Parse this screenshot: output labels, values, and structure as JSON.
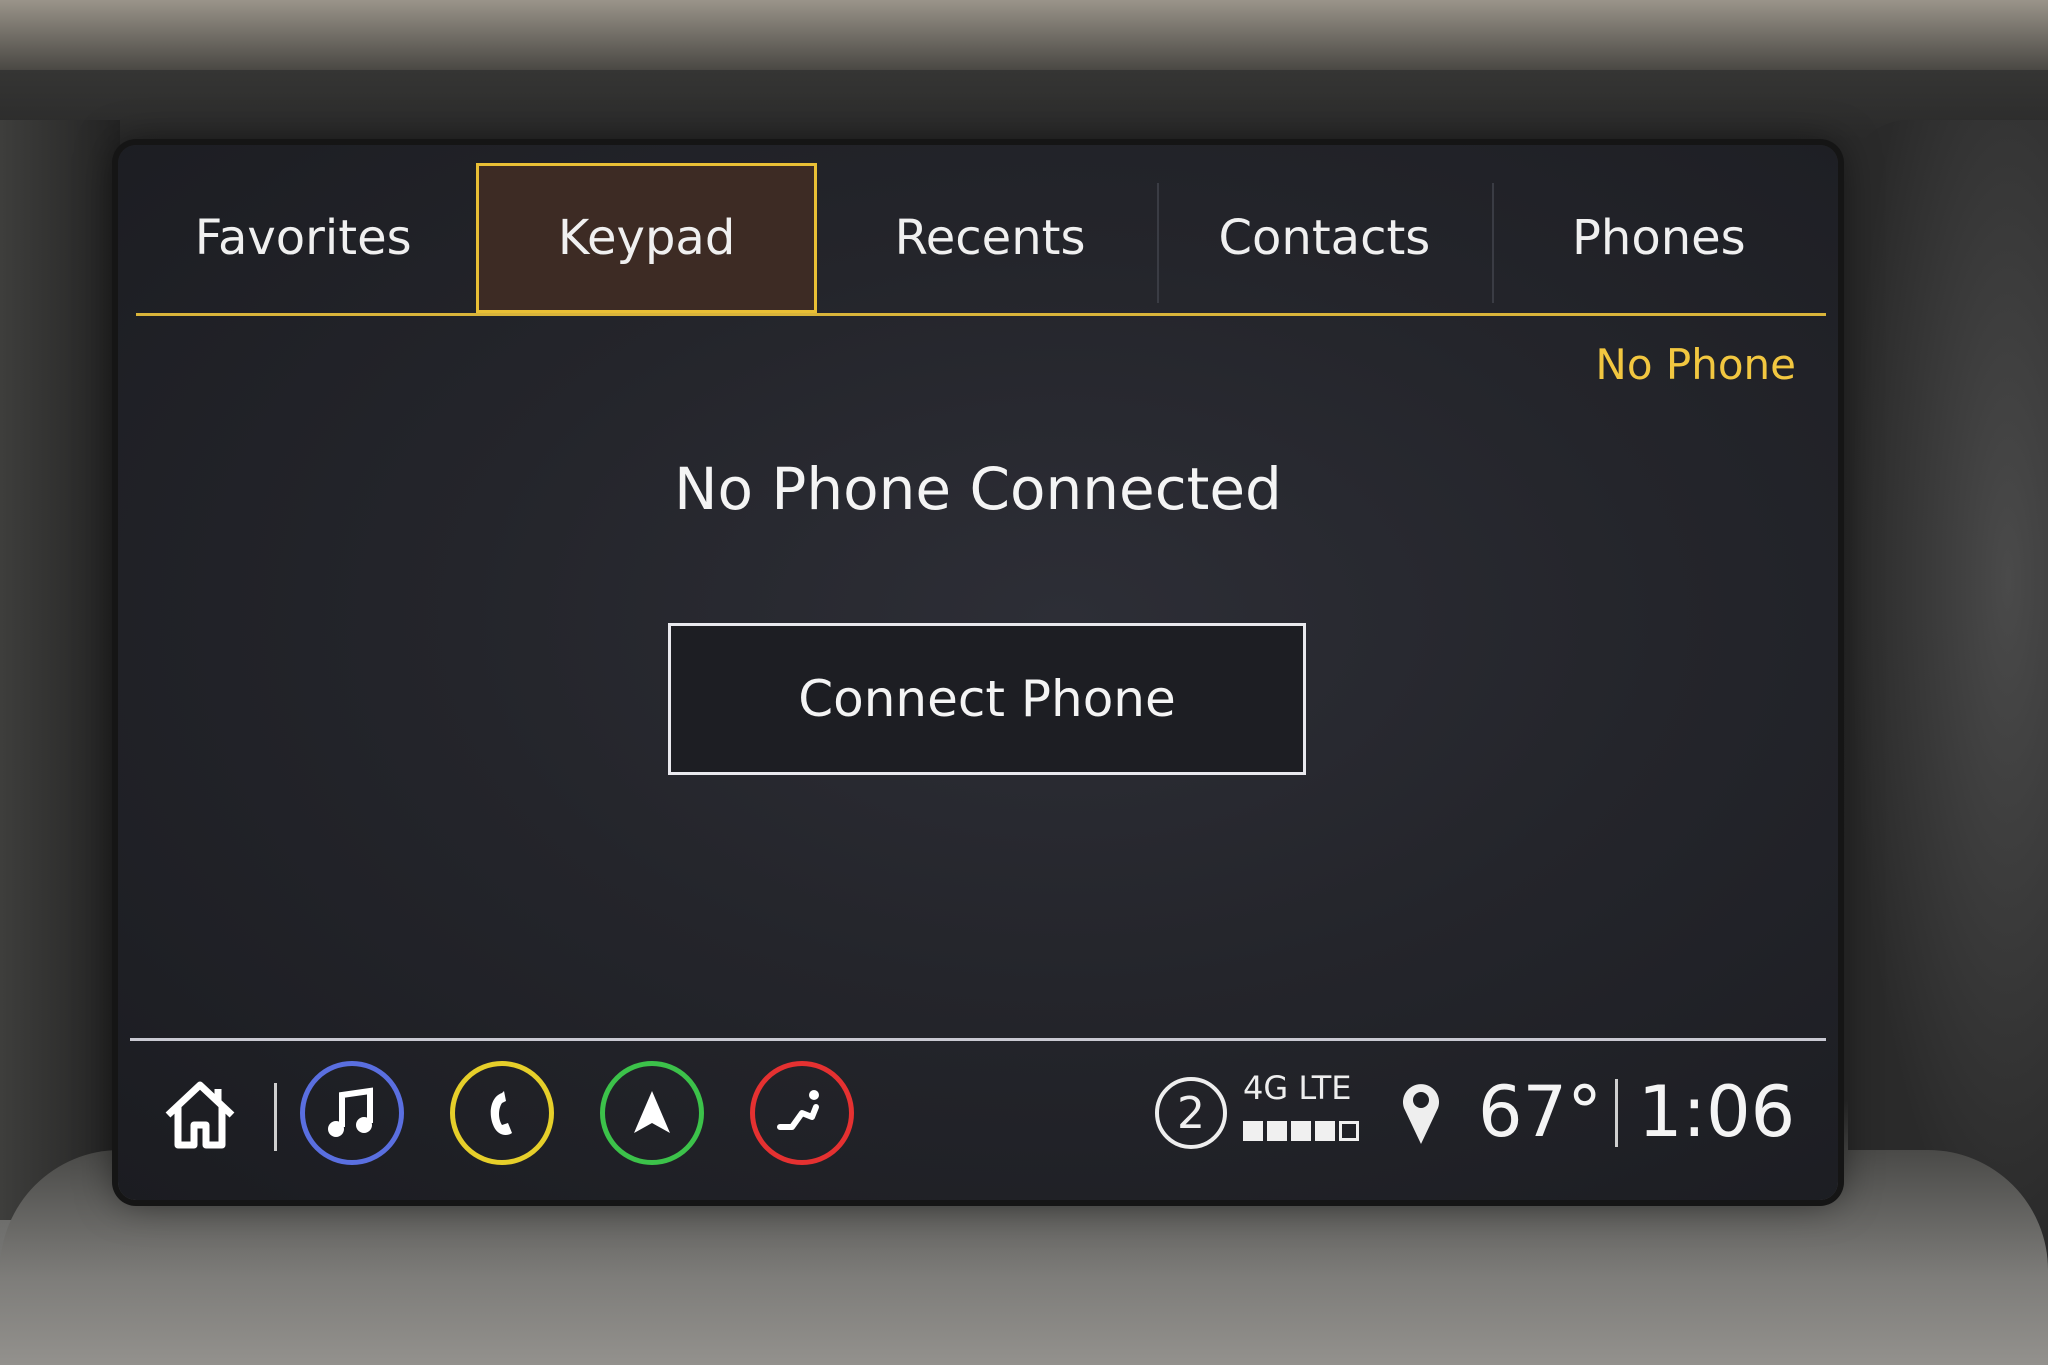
{
  "tabs": [
    {
      "label": "Favorites",
      "active": false
    },
    {
      "label": "Keypad",
      "active": true
    },
    {
      "label": "Recents",
      "active": false
    },
    {
      "label": "Contacts",
      "active": false
    },
    {
      "label": "Phones",
      "active": false
    }
  ],
  "status": "No Phone",
  "message": "No Phone Connected",
  "connect_button": "Connect Phone",
  "bottom_bar": {
    "apps": [
      {
        "icon": "home-icon",
        "color": "#ffffff"
      },
      {
        "icon": "music-icon",
        "color": "#5a6fe0"
      },
      {
        "icon": "phone-icon",
        "color": "#e6cf2a"
      },
      {
        "icon": "navigation-icon",
        "color": "#3cc24a"
      },
      {
        "icon": "onstar-seat-icon",
        "color": "#e53131"
      }
    ],
    "siriusxm_channel": "2",
    "network": "4G LTE",
    "signal_strength": 4,
    "signal_max": 5,
    "temperature": "67°",
    "time": "1:06"
  },
  "colors": {
    "accent": "#e9bf35",
    "status_text": "#f2c740",
    "screen_bg": "#24252b"
  }
}
